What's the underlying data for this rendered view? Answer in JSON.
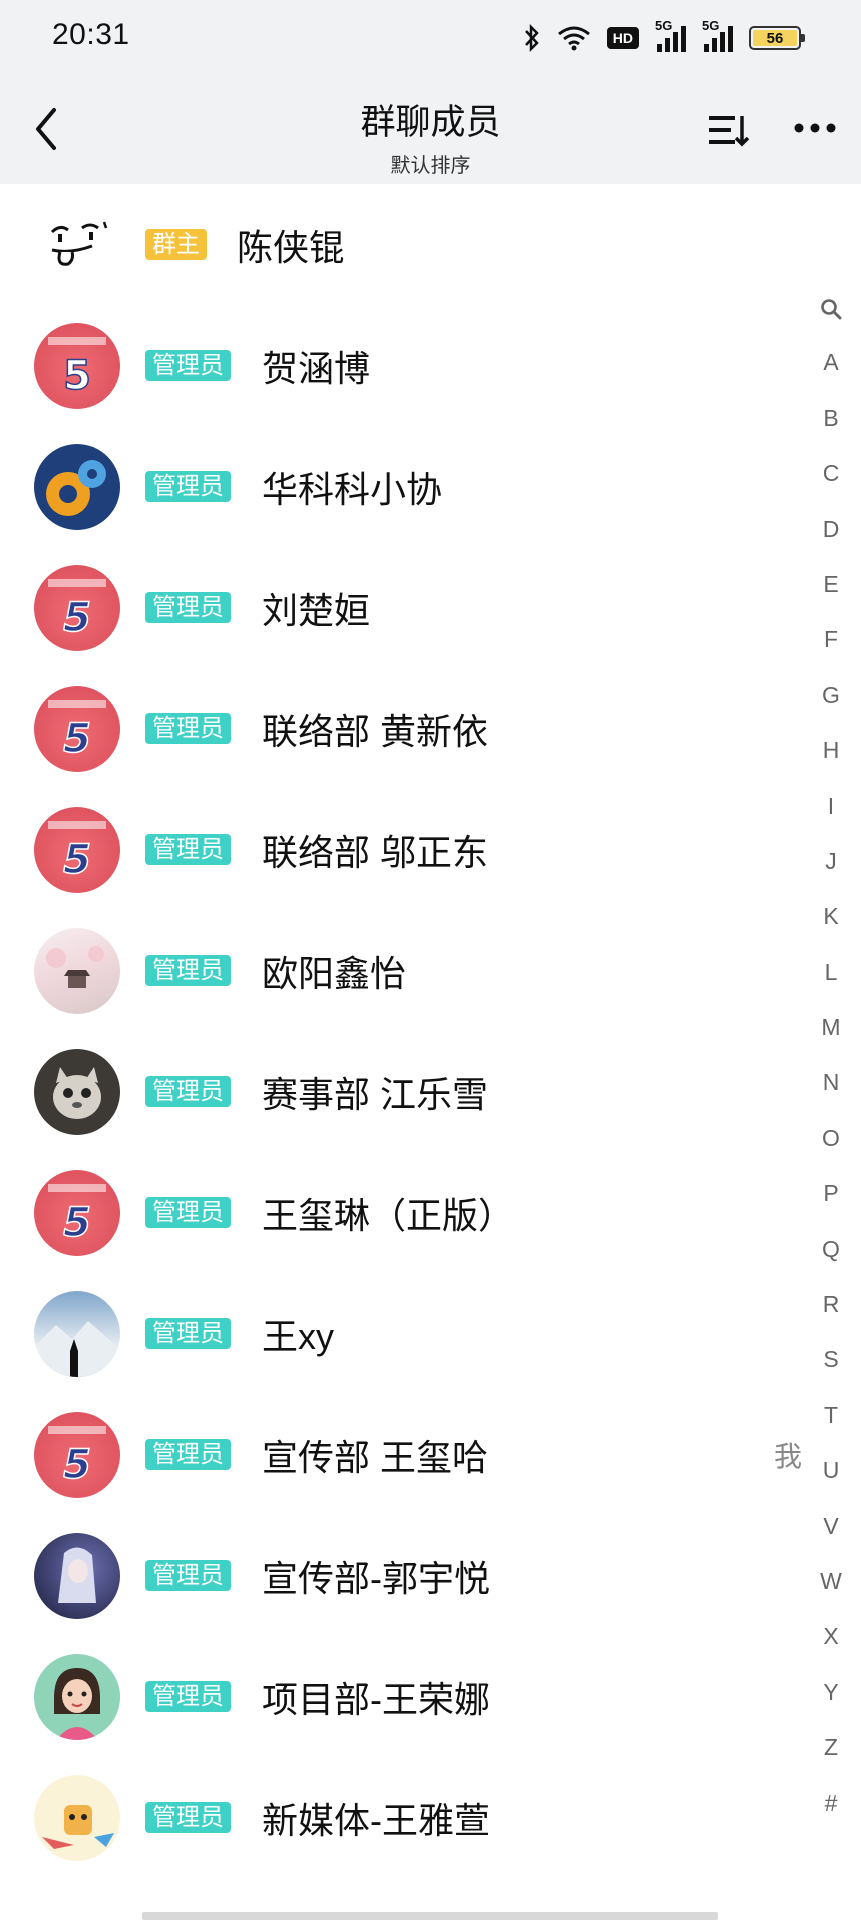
{
  "status_bar": {
    "time": "20:31",
    "hd_label": "HD",
    "signal1_label": "5G",
    "signal2_label": "5G",
    "battery": "56"
  },
  "header": {
    "title": "群聊成员",
    "subtitle": "默认排序"
  },
  "members": [
    {
      "role": "群主",
      "name": "陈侠锟"
    },
    {
      "role": "管理员",
      "name": "贺涵博"
    },
    {
      "role": "管理员",
      "name": "华科科小协"
    },
    {
      "role": "管理员",
      "name": "刘楚姮"
    },
    {
      "role": "管理员",
      "name": "联络部 黄新依"
    },
    {
      "role": "管理员",
      "name": "联络部 邬正东"
    },
    {
      "role": "管理员",
      "name": "欧阳鑫怡"
    },
    {
      "role": "管理员",
      "name": "赛事部 江乐雪"
    },
    {
      "role": "管理员",
      "name": "王玺琳（正版）"
    },
    {
      "role": "管理员",
      "name": "王xy"
    },
    {
      "role": "管理员",
      "name": "宣传部 王玺哈",
      "me_label": "我"
    },
    {
      "role": "管理员",
      "name": "宣传部-郭宇悦"
    },
    {
      "role": "管理员",
      "name": "项目部-王荣娜"
    },
    {
      "role": "管理员",
      "name": "新媒体-王雅萱"
    }
  ],
  "index_letters": [
    "A",
    "B",
    "C",
    "D",
    "E",
    "F",
    "G",
    "H",
    "I",
    "J",
    "K",
    "L",
    "M",
    "N",
    "O",
    "P",
    "Q",
    "R",
    "S",
    "T",
    "U",
    "V",
    "W",
    "X",
    "Y",
    "Z",
    "#"
  ],
  "colors": {
    "owner_badge": "#f7c23b",
    "admin_badge": "#3fd0c6",
    "header_bg": "#f1f2f4"
  }
}
